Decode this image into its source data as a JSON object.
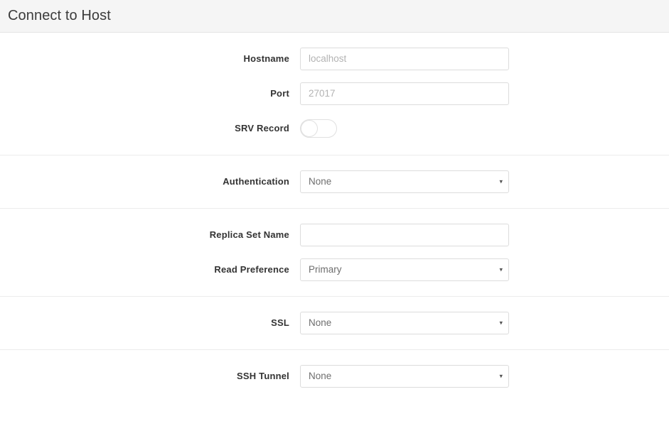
{
  "window": {
    "title": "Connect to Host"
  },
  "form": {
    "sections": [
      {
        "name": "connection",
        "rows": [
          {
            "label": "Hostname",
            "type": "text",
            "value": "",
            "placeholder": "localhost"
          },
          {
            "label": "Port",
            "type": "text",
            "value": "",
            "placeholder": "27017"
          },
          {
            "label": "SRV Record",
            "type": "toggle",
            "value": "off"
          }
        ]
      },
      {
        "name": "authentication",
        "rows": [
          {
            "label": "Authentication",
            "type": "select",
            "value": "None",
            "caret": "▾"
          }
        ]
      },
      {
        "name": "replica-set",
        "rows": [
          {
            "label": "Replica Set Name",
            "type": "text",
            "value": "",
            "placeholder": ""
          },
          {
            "label": "Read Preference",
            "type": "select",
            "value": "Primary",
            "caret": "▾"
          }
        ]
      },
      {
        "name": "ssl",
        "rows": [
          {
            "label": "SSL",
            "type": "select",
            "value": "None",
            "caret": "▾"
          }
        ]
      },
      {
        "name": "ssh-tunnel",
        "rows": [
          {
            "label": "SSH Tunnel",
            "type": "select",
            "value": "None",
            "caret": "▾"
          }
        ]
      }
    ]
  },
  "colors": {
    "header_background": "#f5f5f5",
    "page_background": "#ffffff",
    "label_text": "#333333",
    "placeholder_text": "#b3b3b3",
    "value_text": "#6e6e6e",
    "border": "#dcdcdc",
    "divider": "#ececec"
  }
}
